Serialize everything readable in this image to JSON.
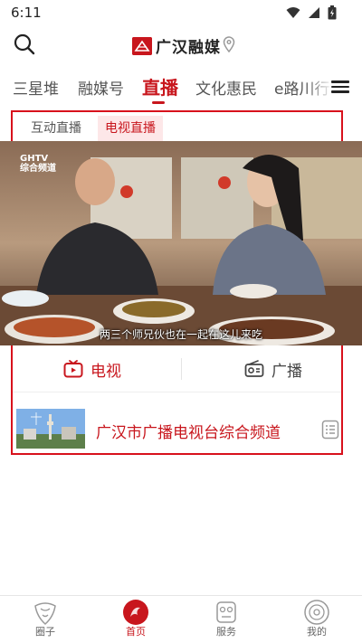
{
  "status_bar": {
    "time": "6:11"
  },
  "header": {
    "app_name": "广汉融媒"
  },
  "channel_tabs": [
    {
      "label": "三星堆",
      "active": false
    },
    {
      "label": "融媒号",
      "active": false
    },
    {
      "label": "直播",
      "active": true
    },
    {
      "label": "文化惠民",
      "active": false
    },
    {
      "label": "e路川行",
      "active": false
    }
  ],
  "live": {
    "subtabs": [
      {
        "label": "互动直播",
        "active": false
      },
      {
        "label": "电视直播",
        "active": true
      }
    ],
    "video": {
      "logo_line1": "GHTV",
      "logo_line2": "综合频道",
      "subtitle": "两三个师兄伙也在一起在这儿来吃"
    },
    "media_switch": {
      "tv_label": "电视",
      "radio_label": "广播",
      "active": "tv"
    },
    "channel": {
      "name": "广汉市广播电视台综合频道"
    }
  },
  "bottom_nav": [
    {
      "label": "圈子",
      "icon": "circle-community-icon",
      "active": false
    },
    {
      "label": "首页",
      "icon": "home-logo-icon",
      "active": true
    },
    {
      "label": "服务",
      "icon": "mask-service-icon",
      "active": false
    },
    {
      "label": "我的",
      "icon": "profile-icon",
      "active": false
    }
  ],
  "colors": {
    "accent": "#c8161d",
    "highlight_border": "#d8111c",
    "subtab_active_bg": "#fde7e8"
  }
}
